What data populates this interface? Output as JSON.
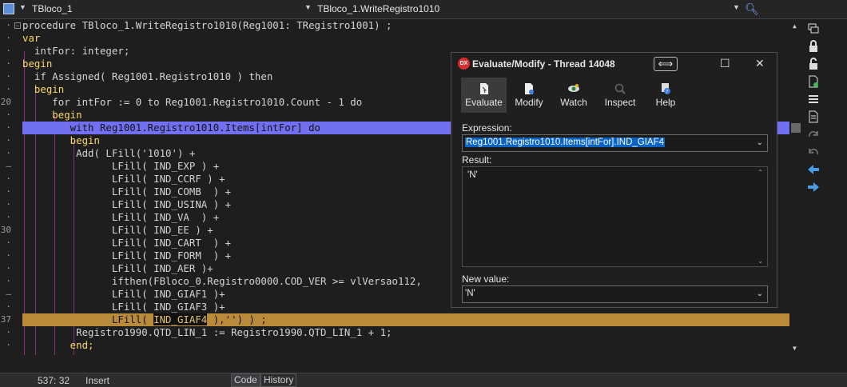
{
  "header": {
    "unit_name": "TBloco_1",
    "method_name": "TBloco_1.WriteRegistro1010"
  },
  "gutter": [
    "·",
    "·",
    "·",
    "·",
    "·",
    "·",
    "20",
    "·",
    "·",
    "·",
    "·",
    "–",
    "·",
    "·",
    "·",
    "·",
    "30",
    "·",
    "·",
    "·",
    "·",
    "–",
    "·",
    "37",
    "·",
    "·"
  ],
  "code": {
    "line0": "procedure TBloco_1.WriteRegistro1010(Reg1001: TRegistro1001) ;",
    "line1": "var",
    "line2": "  intFor: integer;",
    "line3": "begin",
    "line4": "  if Assigned( Reg1001.Registro1010 ) then",
    "line5": "  begin",
    "line6": "     for intFor := 0 to Reg1001.Registro1010.Count - 1 do",
    "line7": "     begin",
    "line8": "        with Reg1001.Registro1010.Items[intFor] do",
    "line9": "        begin",
    "line10": "         Add( LFill('1010') +",
    "line11": "               LFill( IND_EXP ) +",
    "line12": "               LFill( IND_CCRF ) +",
    "line13": "               LFill( IND_COMB  ) +",
    "line14": "               LFill( IND_USINA ) +",
    "line15": "               LFill( IND_VA  ) +",
    "line16": "               LFill( IND_EE ) +",
    "line17": "               LFill( IND_CART  ) +",
    "line18": "               LFill( IND_FORM  ) +",
    "line19": "               LFill( IND_AER )+",
    "line20": "               ifthen(FBloco_0.Registro0000.COD_VER >= vlVersao112,",
    "line21": "               LFill( IND_GIAF1 )+",
    "line22": "               LFill( IND_GIAF3 )+",
    "line23_pre": "               LFill( ",
    "line23_sel": "IND_GIAF4",
    "line23_post": " ),'') ) ;",
    "line24": "         Registro1990.QTD_LIN_1 := Registro1990.QTD_LIN_1 + 1;",
    "line25": "        end;"
  },
  "dialog": {
    "logo": "DX",
    "title": "Evaluate/Modify - Thread 14048",
    "resize_glyph": "⟺",
    "minimize_glyph": "☐",
    "close_glyph": "✕",
    "toolbar": {
      "evaluate": "Evaluate",
      "modify": "Modify",
      "watch": "Watch",
      "inspect": "Inspect",
      "help": "Help"
    },
    "expression_label": "Expression:",
    "expression_value": "Reg1001.Registro1010.Items[intFor].IND_GIAF4",
    "result_label": "Result:",
    "result_value": "'N'",
    "new_value_label": "New value:",
    "new_value": "'N'"
  },
  "status": {
    "position": "537: 32",
    "mode": "Insert",
    "tab_code": "Code",
    "tab_history": "History"
  },
  "colors": {
    "execution_line": "#7070f0",
    "breakpoint_line": "#b88a3a",
    "keyword": "#ffd866",
    "selection_blue": "#0a64c8"
  }
}
